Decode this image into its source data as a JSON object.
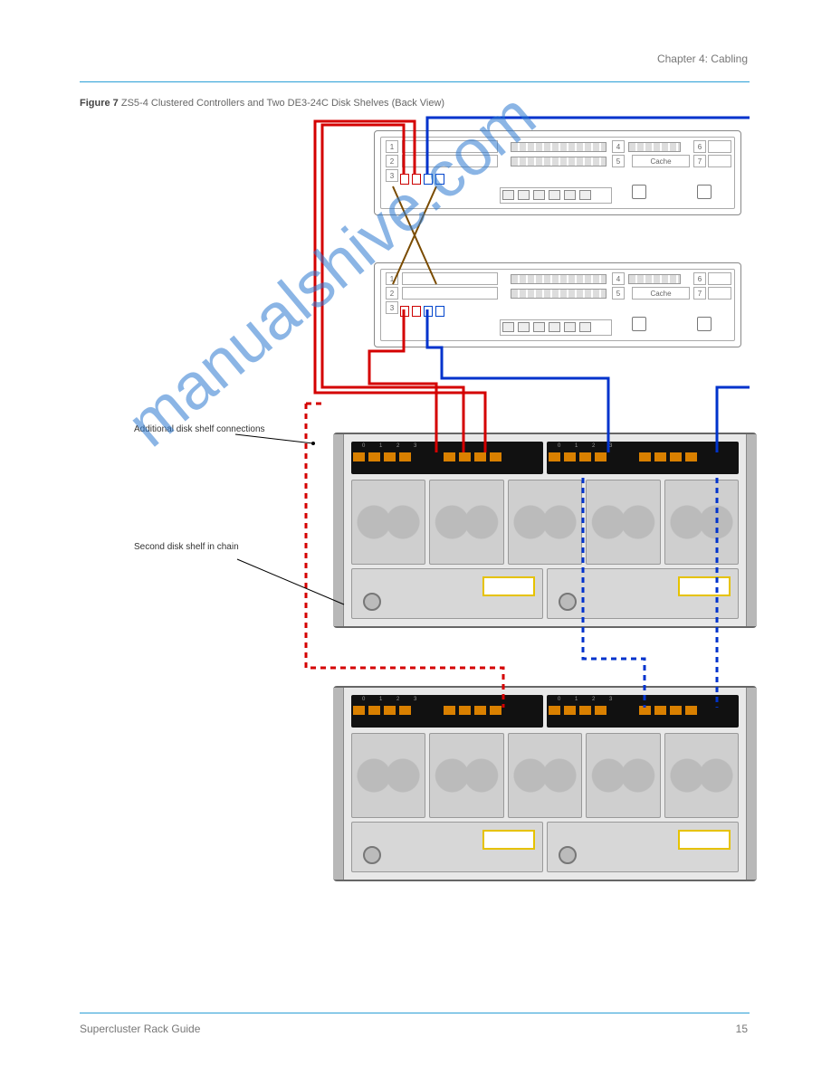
{
  "header": {
    "chapter": "Chapter 4: Cabling"
  },
  "figure": {
    "caption_label": "Figure 7",
    "caption_text": "ZS5-4 Clustered Controllers and Two DE3-24C Disk Shelves (Back View)"
  },
  "device": {
    "slots_left": [
      "1",
      "2",
      "3"
    ],
    "slots_right": [
      "4",
      "6",
      "5",
      "7"
    ],
    "cache_label": "Cache"
  },
  "dashes": {
    "legend1": "Additional disk shelf connections",
    "legend2": "Second disk shelf in chain"
  },
  "footer": {
    "title": "Supercluster Rack Guide",
    "page": "15"
  },
  "watermark": "manualshive.com"
}
